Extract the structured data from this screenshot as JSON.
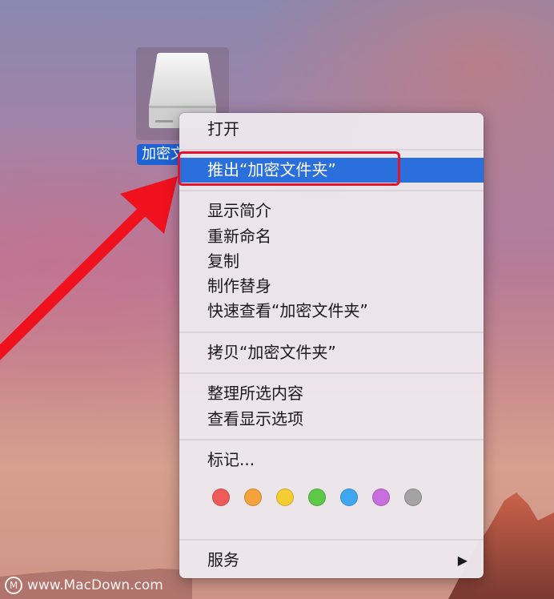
{
  "desktop": {
    "drive": {
      "icon": "external-drive-icon",
      "label": "加密文件夹"
    }
  },
  "context_menu": {
    "items": [
      {
        "label": "打开"
      },
      {
        "label": "推出“加密文件夹”",
        "highlighted": true
      },
      {
        "label": "显示简介"
      },
      {
        "label": "重新命名"
      },
      {
        "label": "复制"
      },
      {
        "label": "制作替身"
      },
      {
        "label": "快速查看“加密文件夹”"
      },
      {
        "label": "拷贝“加密文件夹”"
      },
      {
        "label": "整理所选内容"
      },
      {
        "label": "查看显示选项"
      },
      {
        "label": "标记..."
      },
      {
        "label": "服务",
        "submenu_arrow": "▶"
      }
    ],
    "tag_colors": [
      "#f05a5b",
      "#f5a13c",
      "#f4cd33",
      "#5ec848",
      "#3fa6f2",
      "#c86fdf",
      "#a3a3a3"
    ],
    "highlight_color": "#2a6fdb"
  },
  "annotation": {
    "box_color": "#e0142a",
    "arrow_color": "#f0111e"
  },
  "watermark": {
    "logo": "M",
    "text": "www.MacDown.com"
  }
}
